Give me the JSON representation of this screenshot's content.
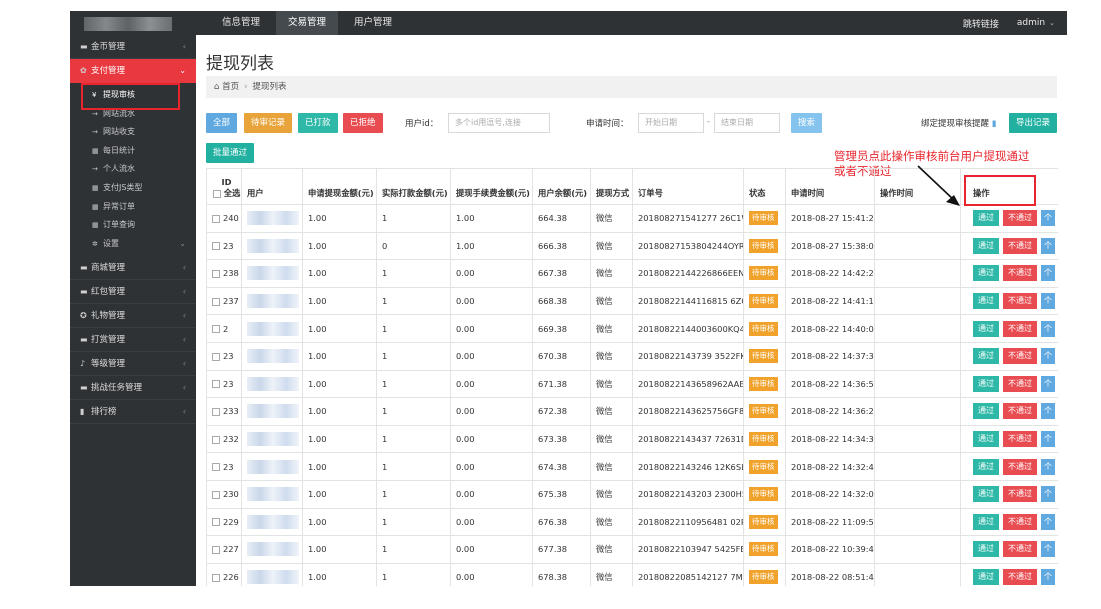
{
  "navbar": {
    "items": [
      {
        "label": "信息管理",
        "active": false
      },
      {
        "label": "交易管理",
        "active": true
      },
      {
        "label": "用户管理",
        "active": false
      }
    ],
    "jump_label": "跳转链接",
    "user_label": "admin"
  },
  "sidebar": {
    "items": [
      {
        "label": "金币管理",
        "icon": "cart-icon",
        "glyph": "▬",
        "arrow": "‹"
      },
      {
        "label": "支付管理",
        "icon": "cogs-icon",
        "glyph": "✿",
        "arrow": "⌄",
        "active": true
      }
    ],
    "subitems": [
      {
        "label": "提现审核",
        "glyph": "¥",
        "current": true
      },
      {
        "label": "网站流水",
        "glyph": "→"
      },
      {
        "label": "网站收支",
        "glyph": "→"
      },
      {
        "label": "每日统计",
        "glyph": "▦"
      },
      {
        "label": "个人流水",
        "glyph": "→"
      },
      {
        "label": "支付JS类型",
        "glyph": "▦"
      },
      {
        "label": "异常订单",
        "glyph": "▦"
      },
      {
        "label": "订单查询",
        "glyph": "▦"
      },
      {
        "label": "设置",
        "glyph": "✲"
      }
    ],
    "lower_items": [
      {
        "label": "商城管理",
        "icon": "cart-icon",
        "glyph": "▬"
      },
      {
        "label": "红包管理",
        "icon": "envelope-icon",
        "glyph": "▬"
      },
      {
        "label": "礼物管理",
        "icon": "gift-icon",
        "glyph": "✪"
      },
      {
        "label": "打赏管理",
        "icon": "reward-icon",
        "glyph": "▬"
      },
      {
        "label": "等级管理",
        "icon": "level-icon",
        "glyph": "♪"
      },
      {
        "label": "挑战任务管理",
        "icon": "task-icon",
        "glyph": "▬"
      },
      {
        "label": "排行榜",
        "icon": "chart-icon",
        "glyph": "▮"
      }
    ],
    "arrow": "‹"
  },
  "page": {
    "title": "提现列表",
    "breadcrumb_home": "首页",
    "breadcrumb_sep": "›",
    "breadcrumb_current": "提现列表",
    "home_glyph": "⌂"
  },
  "toolbar": {
    "all": "全部",
    "pending": "待审记录",
    "paid": "已打款",
    "rejected": "已拒绝",
    "user_id_label": "用户id：",
    "user_id_placeholder": "多个id用逗号,连接",
    "date_label": "申请时间：",
    "start_placeholder": "开始日期",
    "dash": "-",
    "end_placeholder": "结束日期",
    "search": "搜索",
    "bind_link": "绑定提现审核提醒",
    "bind_glyph": "▮",
    "export": "导出记录",
    "batch": "批量通过"
  },
  "annotation": {
    "line1": "管理员点此操作审核前台用户提现通过",
    "line2": "或者不通过"
  },
  "table": {
    "headers": {
      "id": "ID",
      "select_all": "全选",
      "user": "用户",
      "apply_amount": "申请提现金额(元)",
      "actual_amount": "实际打款金额(元)",
      "fee": "提现手续费金额(元)",
      "balance": "用户余额(元)",
      "method": "提现方式",
      "order_no": "订单号",
      "status": "状态",
      "apply_time": "申请时间",
      "op_time": "操作时间",
      "action": "操作"
    },
    "pass_label": "通过",
    "fail_label": "不通过",
    "more_label": "个",
    "rows": [
      {
        "id": "240",
        "apply": "1.00",
        "actual": "1",
        "fee": "1.00",
        "balance": "664.38",
        "method": "微信",
        "order": "201808271541277 26C1W",
        "status": "待审核",
        "time": "2018-08-27 15:41:27"
      },
      {
        "id": "23",
        "apply": "1.00",
        "actual": "0",
        "fee": "1.00",
        "balance": "666.38",
        "method": "微信",
        "order": "20180827153804244OYR",
        "status": "待审核",
        "time": "2018-08-27 15:38:04"
      },
      {
        "id": "238",
        "apply": "1.00",
        "actual": "1",
        "fee": "0.00",
        "balance": "667.38",
        "method": "微信",
        "order": "20180822144226866EEN",
        "status": "待审核",
        "time": "2018-08-22 14:42:26"
      },
      {
        "id": "237",
        "apply": "1.00",
        "actual": "1",
        "fee": "0.00",
        "balance": "668.38",
        "method": "微信",
        "order": "20180822144116815 6ZG",
        "status": "待审核",
        "time": "2018-08-22 14:41:16"
      },
      {
        "id": "2",
        "apply": "1.00",
        "actual": "1",
        "fee": "0.00",
        "balance": "669.38",
        "method": "微信",
        "order": "20180822144003600KQ4",
        "status": "待审核",
        "time": "2018-08-22 14:40:03"
      },
      {
        "id": "23",
        "apply": "1.00",
        "actual": "1",
        "fee": "0.00",
        "balance": "670.38",
        "method": "微信",
        "order": "20180822143739 3522FK",
        "status": "待审核",
        "time": "2018-08-22 14:37:39"
      },
      {
        "id": "23",
        "apply": "1.00",
        "actual": "1",
        "fee": "0.00",
        "balance": "671.38",
        "method": "微信",
        "order": "20180822143658962AAE",
        "status": "待审核",
        "time": "2018-08-22 14:36:58"
      },
      {
        "id": "233",
        "apply": "1.00",
        "actual": "1",
        "fee": "0.00",
        "balance": "672.38",
        "method": "微信",
        "order": "20180822143625756GF8",
        "status": "待审核",
        "time": "2018-08-22 14:36:25"
      },
      {
        "id": "232",
        "apply": "1.00",
        "actual": "1",
        "fee": "0.00",
        "balance": "673.38",
        "method": "微信",
        "order": "20180822143437 72631D",
        "status": "待审核",
        "time": "2018-08-22 14:34:37"
      },
      {
        "id": "23",
        "apply": "1.00",
        "actual": "1",
        "fee": "0.00",
        "balance": "674.38",
        "method": "微信",
        "order": "20180822143246 12K6SL",
        "status": "待审核",
        "time": "2018-08-22 14:32:45"
      },
      {
        "id": "230",
        "apply": "1.00",
        "actual": "1",
        "fee": "0.00",
        "balance": "675.38",
        "method": "微信",
        "order": "20180822143203 2300H5",
        "status": "待审核",
        "time": "2018-08-22 14:32:03"
      },
      {
        "id": "229",
        "apply": "1.00",
        "actual": "1",
        "fee": "0.00",
        "balance": "676.38",
        "method": "微信",
        "order": "20180822110956481 02P",
        "status": "待审核",
        "time": "2018-08-22 11:09:56"
      },
      {
        "id": "227",
        "apply": "1.00",
        "actual": "1",
        "fee": "0.00",
        "balance": "677.38",
        "method": "微信",
        "order": "20180822103947 5425FB",
        "status": "待审核",
        "time": "2018-08-22 10:39:47"
      },
      {
        "id": "226",
        "apply": "1.00",
        "actual": "1",
        "fee": "0.00",
        "balance": "678.38",
        "method": "微信",
        "order": "20180822085142127 7MX",
        "status": "待审核",
        "time": "2018-08-22 08:51:42"
      }
    ]
  },
  "colors": {
    "nav_bg": "#2f3235",
    "sidebar_active": "#e9383f",
    "annotation_red": "#e8242c",
    "pass_btn": "#2eb8a7",
    "fail_btn": "#e84c51",
    "status_tag": "#f0a22a"
  }
}
